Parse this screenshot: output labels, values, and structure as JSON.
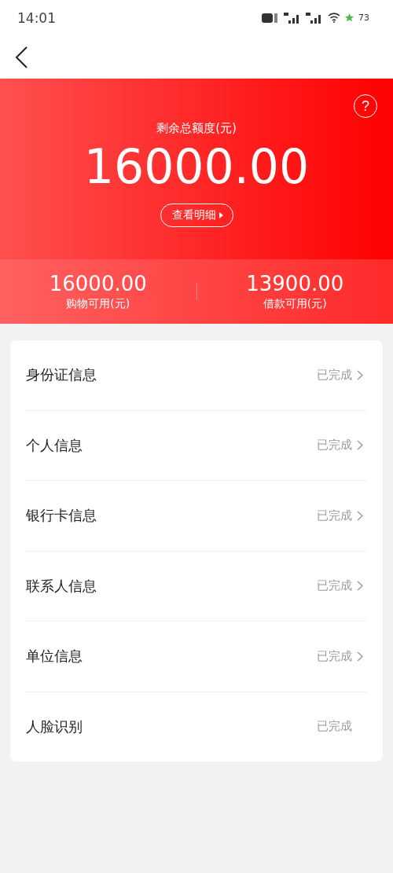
{
  "status_bar": {
    "time": "14:01",
    "battery": "73"
  },
  "summary": {
    "help": "?",
    "label": "剩余总额度(元)",
    "amount": "16000.00",
    "detail_button": "查看明细"
  },
  "balances": [
    {
      "amount": "16000.00",
      "label": "购物可用(元)"
    },
    {
      "amount": "13900.00",
      "label": "借款可用(元)"
    }
  ],
  "items": [
    {
      "label": "身份证信息",
      "status": "已完成",
      "chevron": true
    },
    {
      "label": "个人信息",
      "status": "已完成",
      "chevron": true
    },
    {
      "label": "银行卡信息",
      "status": "已完成",
      "chevron": true
    },
    {
      "label": "联系人信息",
      "status": "已完成",
      "chevron": true
    },
    {
      "label": "单位信息",
      "status": "已完成",
      "chevron": true
    },
    {
      "label": "人脸识别",
      "status": "已完成",
      "chevron": false
    }
  ]
}
